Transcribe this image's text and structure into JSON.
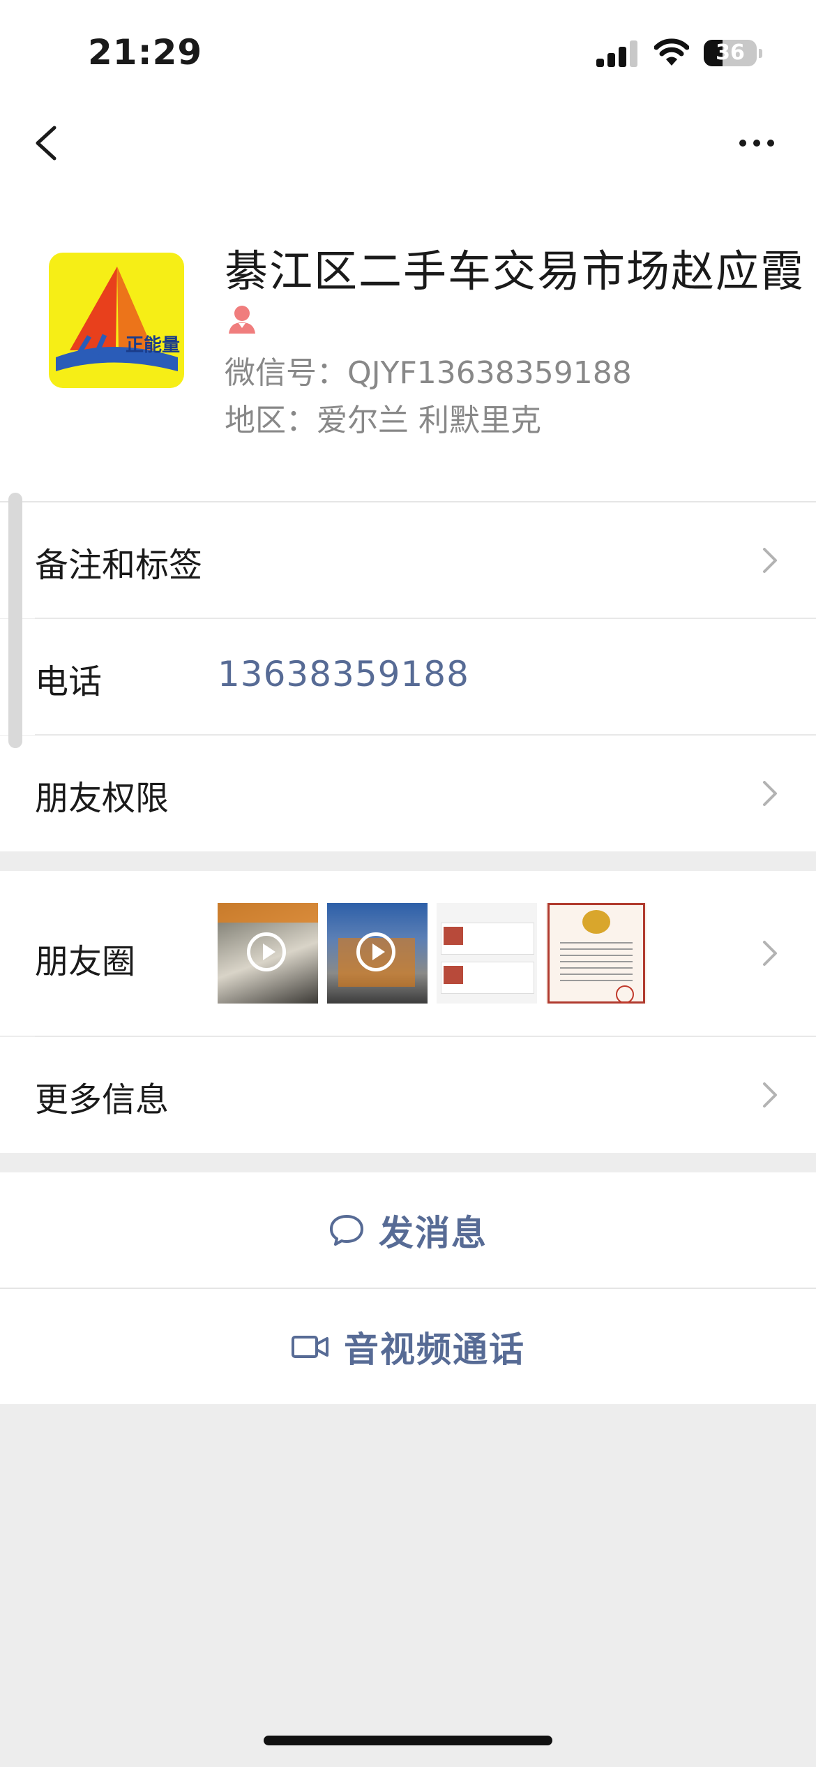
{
  "status_bar": {
    "time": "21:29",
    "battery": "36"
  },
  "nav": {
    "back_icon": "chevron-left-icon",
    "more_icon": "more-dots-icon"
  },
  "profile": {
    "avatar_text": "正能量",
    "name": "綦江区二手车交易市场赵应霞",
    "gender_icon": "female-user-icon",
    "wechat_id": "微信号：QJYF13638359188",
    "region": "地区：爱尔兰 利默里克"
  },
  "rows": {
    "remark_label": "备注和标签",
    "phone_label": "电话",
    "phone_value": "13638359188",
    "permission_label": "朋友权限",
    "moments_label": "朋友圈",
    "more_info_label": "更多信息"
  },
  "actions": {
    "message_label": "发消息",
    "call_label": "音视频通话"
  },
  "colors": {
    "link": "#576b95",
    "background": "#ededed"
  }
}
